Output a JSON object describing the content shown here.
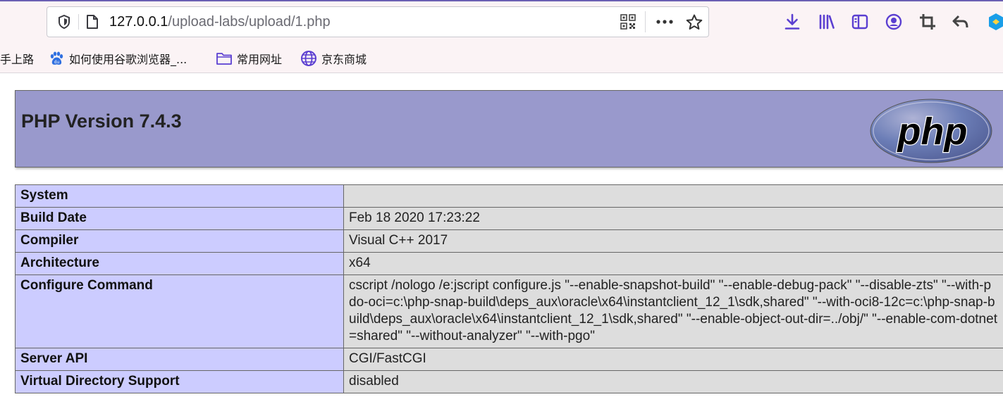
{
  "browser": {
    "url_host": "127.0.0.1",
    "url_path": "/upload-labs/upload/1.php",
    "accent": "#6b5fb3"
  },
  "bookmarks": [
    {
      "label": "手上路",
      "icon": "none"
    },
    {
      "label": "如何使用谷歌浏览器_...",
      "icon": "baidu-paw-icon"
    },
    {
      "label": "常用网址",
      "icon": "folder-icon"
    },
    {
      "label": "京东商城",
      "icon": "globe-icon"
    }
  ],
  "php": {
    "title": "PHP Version 7.4.3",
    "logo_text": "php",
    "header_color": "#9999cc",
    "key_color": "#ccccff",
    "value_color": "#dddddd"
  },
  "info_rows": [
    {
      "key": "System",
      "value": ""
    },
    {
      "key": "Build Date",
      "value": "Feb 18 2020 17:23:22"
    },
    {
      "key": "Compiler",
      "value": "Visual C++ 2017"
    },
    {
      "key": "Architecture",
      "value": "x64"
    },
    {
      "key": "Configure Command",
      "value": "cscript /nologo /e:jscript configure.js \"--enable-snapshot-build\" \"--enable-debug-pack\" \"--disable-zts\" \"--with-pdo-oci=c:\\php-snap-build\\deps_aux\\oracle\\x64\\instantclient_12_1\\sdk,shared\" \"--with-oci8-12c=c:\\php-snap-build\\deps_aux\\oracle\\x64\\instantclient_12_1\\sdk,shared\" \"--enable-object-out-dir=../obj/\" \"--enable-com-dotnet=shared\" \"--without-analyzer\" \"--with-pgo\""
    },
    {
      "key": "Server API",
      "value": "CGI/FastCGI"
    },
    {
      "key": "Virtual Directory Support",
      "value": "disabled"
    }
  ]
}
